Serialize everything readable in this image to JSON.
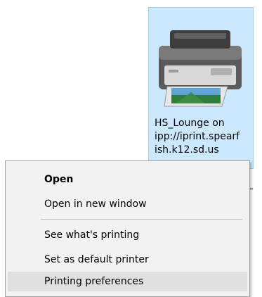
{
  "explorer": {
    "printer_tile": {
      "name_lines": [
        "HS_Lounge on",
        "ipp://iprint.spearf",
        "ish.k12.sd.us"
      ],
      "icon": "printer-icon",
      "selected": true
    },
    "partial_label": "HS_L"
  },
  "context_menu": {
    "items": [
      {
        "label": "Open",
        "bold": true
      },
      {
        "label": "Open in new window"
      },
      {
        "label": "See what's printing"
      },
      {
        "label": "Set as default printer"
      },
      {
        "label": "Printing preferences",
        "highlighted": true
      }
    ]
  },
  "colors": {
    "selection_fill": "#cce8ff",
    "selection_border": "#99d1ff",
    "menu_background": "#f2f2f2",
    "menu_hover": "#e0e0e0"
  }
}
